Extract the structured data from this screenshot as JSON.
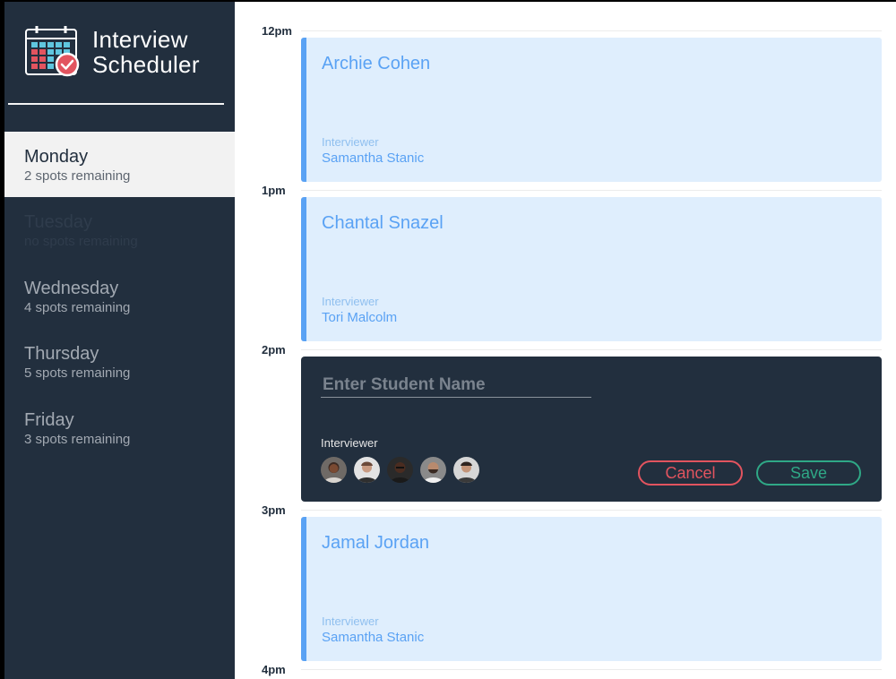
{
  "app": {
    "title_line1": "Interview",
    "title_line2": "Scheduler"
  },
  "days": [
    {
      "name": "Monday",
      "spots": "2 spots remaining",
      "state": "selected"
    },
    {
      "name": "Tuesday",
      "spots": "no spots remaining",
      "state": "full"
    },
    {
      "name": "Wednesday",
      "spots": "4 spots remaining",
      "state": "normal"
    },
    {
      "name": "Thursday",
      "spots": "5 spots remaining",
      "state": "normal"
    },
    {
      "name": "Friday",
      "spots": "3 spots remaining",
      "state": "normal"
    }
  ],
  "times": [
    "12pm",
    "1pm",
    "2pm",
    "3pm",
    "4pm"
  ],
  "appointments": [
    {
      "student": "Archie Cohen",
      "interviewer_label": "Interviewer",
      "interviewer": "Samantha Stanic"
    },
    {
      "student": "Chantal Snazel",
      "interviewer_label": "Interviewer",
      "interviewer": "Tori Malcolm"
    },
    {
      "student": "Jamal Jordan",
      "interviewer_label": "Interviewer",
      "interviewer": "Samantha Stanic"
    }
  ],
  "form": {
    "placeholder": "Enter Student Name",
    "value": "",
    "interviewer_label": "Interviewer",
    "interviewer_avatars": [
      "avatar-1",
      "avatar-2",
      "avatar-3",
      "avatar-4",
      "avatar-5"
    ],
    "cancel_label": "Cancel",
    "save_label": "Save"
  },
  "colors": {
    "sidebar_bg": "#222f3e",
    "appointment_bg": "#dfeefd",
    "accent_blue": "#5aa2f4",
    "cancel_red": "#e2545f",
    "save_green": "#2fa886"
  }
}
